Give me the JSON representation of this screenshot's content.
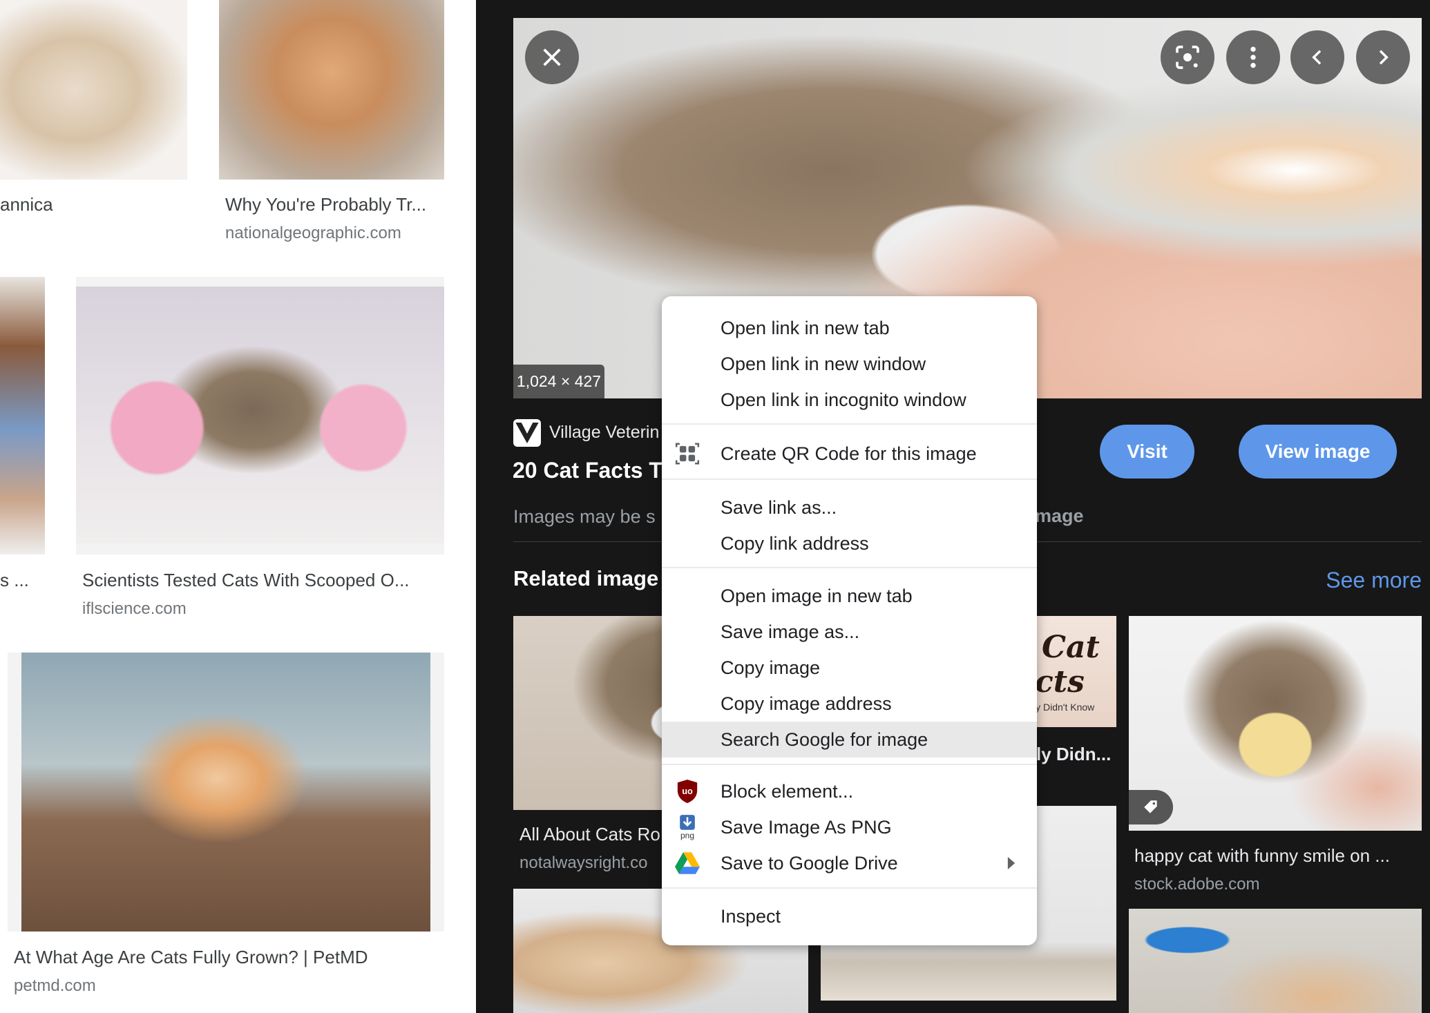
{
  "left_results": [
    {
      "title": "annica",
      "domain": ""
    },
    {
      "title": "Why You're Probably Tr...",
      "domain": "nationalgeographic.com"
    },
    {
      "title": "s ...",
      "domain": ""
    },
    {
      "title": "Scientists Tested Cats With Scooped O...",
      "domain": "iflscience.com"
    },
    {
      "title": "At What Age Are Cats Fully Grown? | PetMD",
      "domain": "petmd.com"
    }
  ],
  "preview": {
    "size_badge": "1,024 × 427",
    "source": "Village Veterin",
    "title": "20 Cat Facts T",
    "copyright_start": "Images may be s",
    "copyright_end": "mage",
    "visit_label": "Visit",
    "view_image_label": "View image",
    "related_heading": "Related image",
    "see_more": "See more",
    "accent": "#5e97e9"
  },
  "related": [
    {
      "title": "All About Cats Ro",
      "domain": "notalwaysright.co"
    },
    {
      "title": "ly Didn...",
      "domain": ""
    },
    {
      "title": "happy cat with funny smile on ...",
      "domain": "stock.adobe.com"
    }
  ],
  "related_thumb_text": {
    "line1": "Cat",
    "line2": "cts",
    "line3": "ly Didn't Know"
  },
  "context_menu": {
    "items": [
      "Open link in new tab",
      "Open link in new window",
      "Open link in incognito window",
      "Create QR Code for this image",
      "Save link as...",
      "Copy link address",
      "Open image in new tab",
      "Save image as...",
      "Copy image",
      "Copy image address",
      "Search Google for image",
      "Block element...",
      "Save Image As PNG",
      "Save to Google Drive",
      "Inspect"
    ],
    "highlighted": "Search Google for image",
    "png_icon_label": "png"
  }
}
